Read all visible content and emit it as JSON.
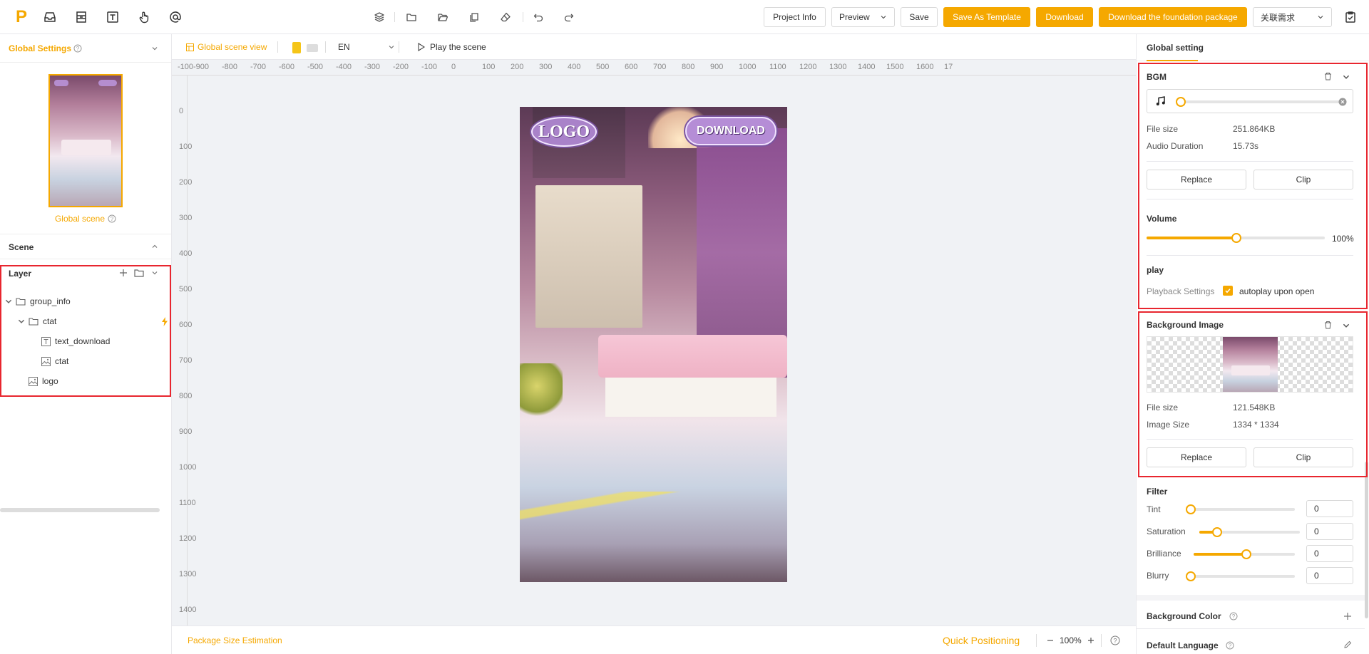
{
  "topbar": {
    "logo": "P",
    "left_icons": [
      "inbox-icon",
      "layout-icon",
      "text-icon",
      "touch-icon",
      "at-icon"
    ],
    "center_icons": [
      "layers-icon",
      "folder-icon",
      "folder-open-icon",
      "copy-icon",
      "eraser-icon",
      "undo-icon",
      "redo-icon"
    ],
    "buttons": {
      "project_info": "Project Info",
      "preview": "Preview",
      "save": "Save",
      "save_as_template": "Save As Template",
      "download": "Download",
      "download_foundation": "Download the foundation package",
      "related_needs": "关联需求"
    }
  },
  "left": {
    "global_settings": "Global Settings",
    "global_scene": "Global scene",
    "scene_title": "Scene",
    "layer_title": "Layer",
    "layers": [
      {
        "name": "group_info",
        "type": "folder",
        "depth": 0
      },
      {
        "name": "ctat",
        "type": "folder",
        "depth": 1
      },
      {
        "name": "text_download",
        "type": "text",
        "depth": 2
      },
      {
        "name": "ctat",
        "type": "image",
        "depth": 2
      },
      {
        "name": "logo",
        "type": "image",
        "depth": 1
      }
    ]
  },
  "canvas": {
    "global_scene_view": "Global scene view",
    "language": "EN",
    "play_scene": "Play the scene",
    "ruler_x": [
      "-100",
      "-900",
      "-800",
      "-700",
      "-600",
      "-500",
      "-400",
      "-300",
      "-200",
      "-100",
      "0",
      "100",
      "200",
      "300",
      "400",
      "500",
      "600",
      "700",
      "800",
      "900",
      "1000",
      "1100",
      "1200",
      "1300",
      "1400",
      "1500",
      "1600",
      "17"
    ],
    "ruler_y": [
      "0",
      "100",
      "200",
      "300",
      "400",
      "500",
      "600",
      "700",
      "800",
      "900",
      "1000",
      "1100",
      "1200",
      "1300",
      "1400"
    ],
    "logo_text": "LOGO",
    "download_text": "DOWNLOAD",
    "package_size": "Package Size Estimation",
    "quick_positioning": "Quick Positioning",
    "zoom": "100%"
  },
  "right": {
    "header": "Global setting",
    "bgm": {
      "title": "BGM",
      "file_size_label": "File size",
      "file_size": "251.864KB",
      "duration_label": "Audio Duration",
      "duration": "15.73s",
      "replace": "Replace",
      "clip": "Clip",
      "volume_label": "Volume",
      "volume_value": "100%",
      "volume_level": 0.5,
      "play_label": "play",
      "playback_label": "Playback Settings",
      "autoplay_label": "autoplay upon open",
      "autoplay_checked": true
    },
    "bg_image": {
      "title": "Background Image",
      "file_size_label": "File size",
      "file_size": "121.548KB",
      "image_size_label": "Image Size",
      "image_size": "1334 * 1334",
      "replace": "Replace",
      "clip": "Clip"
    },
    "filter": {
      "title": "Filter",
      "items": [
        {
          "label": "Tint",
          "value": "0",
          "level": 0.0
        },
        {
          "label": "Saturation",
          "value": "0",
          "level": 0.15
        },
        {
          "label": "Brilliance",
          "value": "0",
          "level": 0.5
        },
        {
          "label": "Blurry",
          "value": "0",
          "level": 0.0
        }
      ]
    },
    "bg_color": "Background Color",
    "default_language": "Default Language"
  },
  "colors": {
    "accent": "#f5a800",
    "highlight": "#e8262f"
  }
}
